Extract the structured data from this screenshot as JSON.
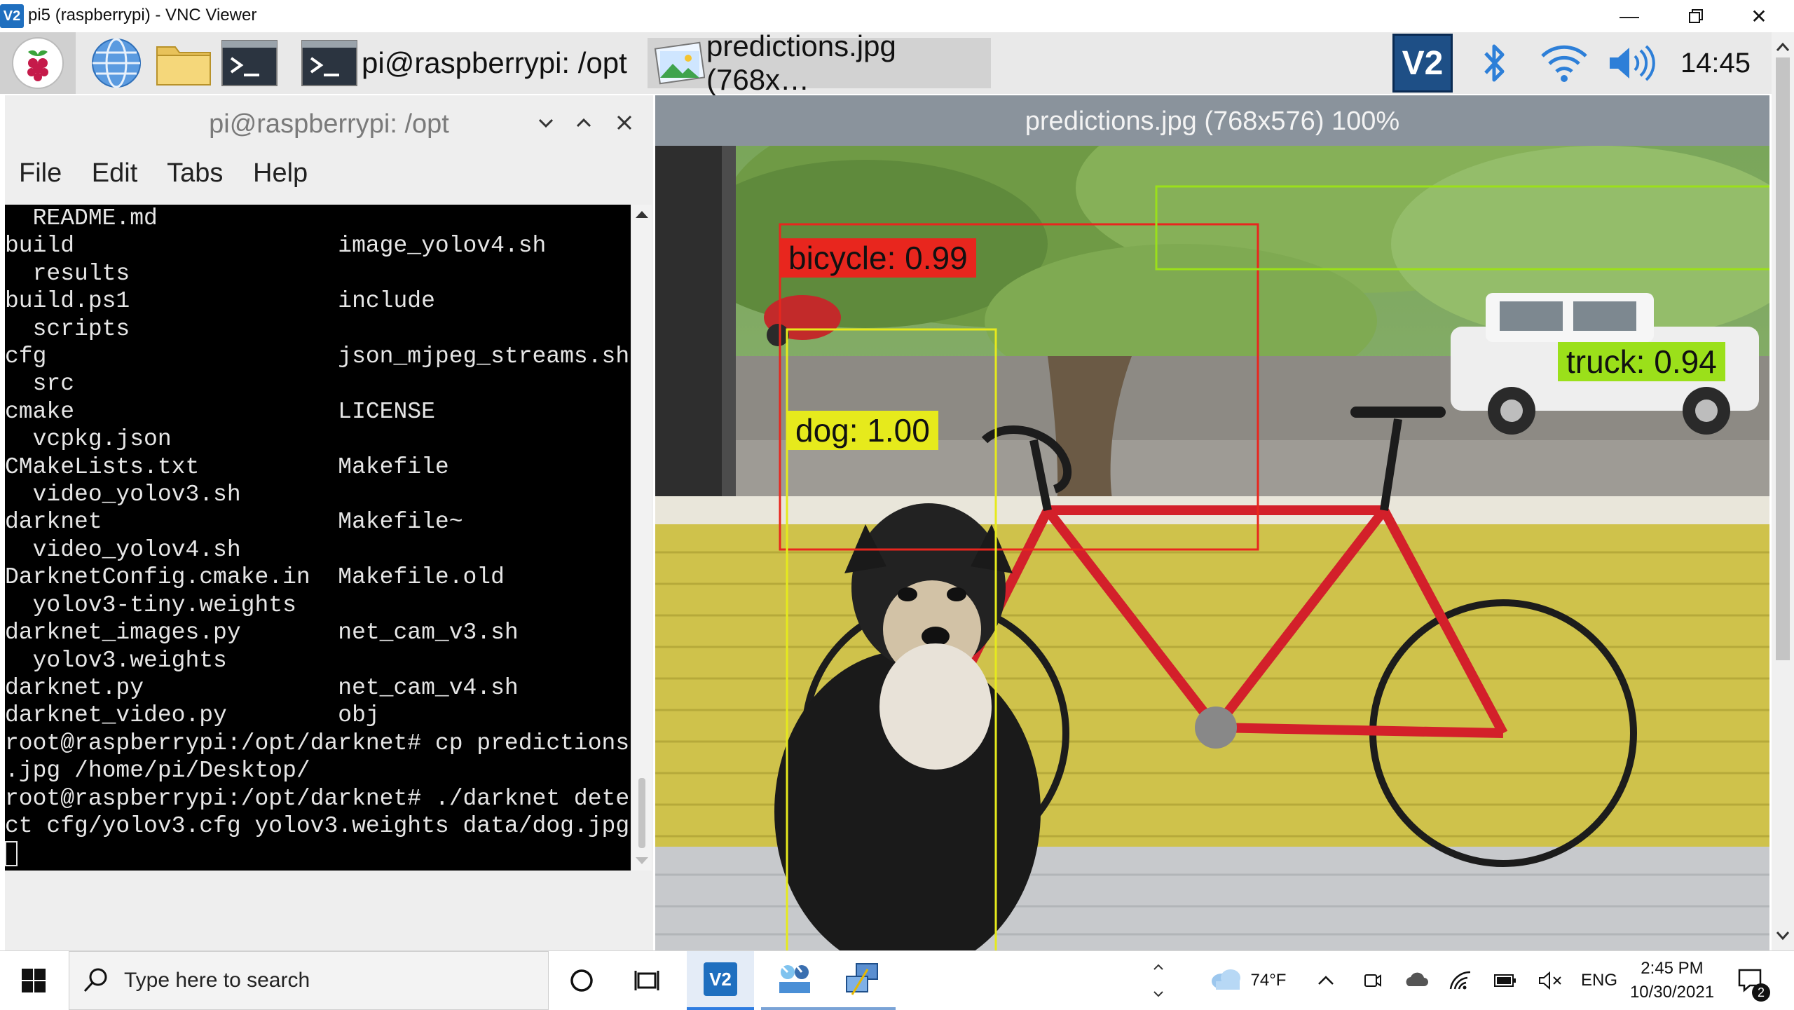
{
  "vnc": {
    "title": "pi5 (raspberrypi) - VNC Viewer",
    "logo_text": "V2",
    "controls": [
      "minimize-icon",
      "restore-icon",
      "close-icon"
    ]
  },
  "pi_taskbar": {
    "launchers": [
      "raspberry-menu-icon",
      "web-browser-icon",
      "file-manager-icon",
      "terminal-icon"
    ],
    "tasks": [
      {
        "label": "pi@raspberrypi: /opt",
        "icon": "terminal-icon"
      },
      {
        "label": "predictions.jpg (768x…",
        "icon": "image-viewer-icon"
      }
    ],
    "tray": [
      "vnc-server-icon",
      "bluetooth-icon",
      "wifi-icon",
      "volume-icon"
    ],
    "clock": "14:45",
    "vnc_badge": "V2"
  },
  "terminal": {
    "title": "pi@raspberrypi: /opt",
    "menu": [
      "File",
      "Edit",
      "Tabs",
      "Help"
    ],
    "lines": [
      "  README.md",
      "build                   image_yolov4.sh",
      "  results",
      "build.ps1               include",
      "  scripts",
      "cfg                     json_mjpeg_streams.sh",
      "  src",
      "cmake                   LICENSE",
      "  vcpkg.json",
      "CMakeLists.txt          Makefile",
      "  video_yolov3.sh",
      "darknet                 Makefile~",
      "  video_yolov4.sh",
      "DarknetConfig.cmake.in  Makefile.old",
      "  yolov3-tiny.weights",
      "darknet_images.py       net_cam_v3.sh",
      "  yolov3.weights",
      "darknet.py              net_cam_v4.sh",
      "darknet_video.py        obj",
      "root@raspberrypi:/opt/darknet# cp predictions",
      ".jpg /home/pi/Desktop/",
      "root@raspberrypi:/opt/darknet# ./darknet dete",
      "ct cfg/yolov3.cfg yolov3.weights data/dog.jpg"
    ]
  },
  "viewer": {
    "title": "predictions.jpg (768x576) 100%",
    "detections": [
      {
        "label": "bicycle: 0.99",
        "color": "#e8261e"
      },
      {
        "label": "truck: 0.94",
        "color": "#9be01a"
      },
      {
        "label": "dog: 1.00",
        "color": "#e6ea1c"
      }
    ]
  },
  "win_taskbar": {
    "search_placeholder": "Type here to search",
    "pinned": [
      "start-icon",
      "search-icon",
      "cortana-icon",
      "task-view-icon",
      "vnc-viewer-icon",
      "network-tool-icon",
      "remote-desktop-icon"
    ],
    "weather": "74°F",
    "lang": "ENG",
    "time": "2:45 PM",
    "date": "10/30/2021",
    "notifications": "2"
  }
}
